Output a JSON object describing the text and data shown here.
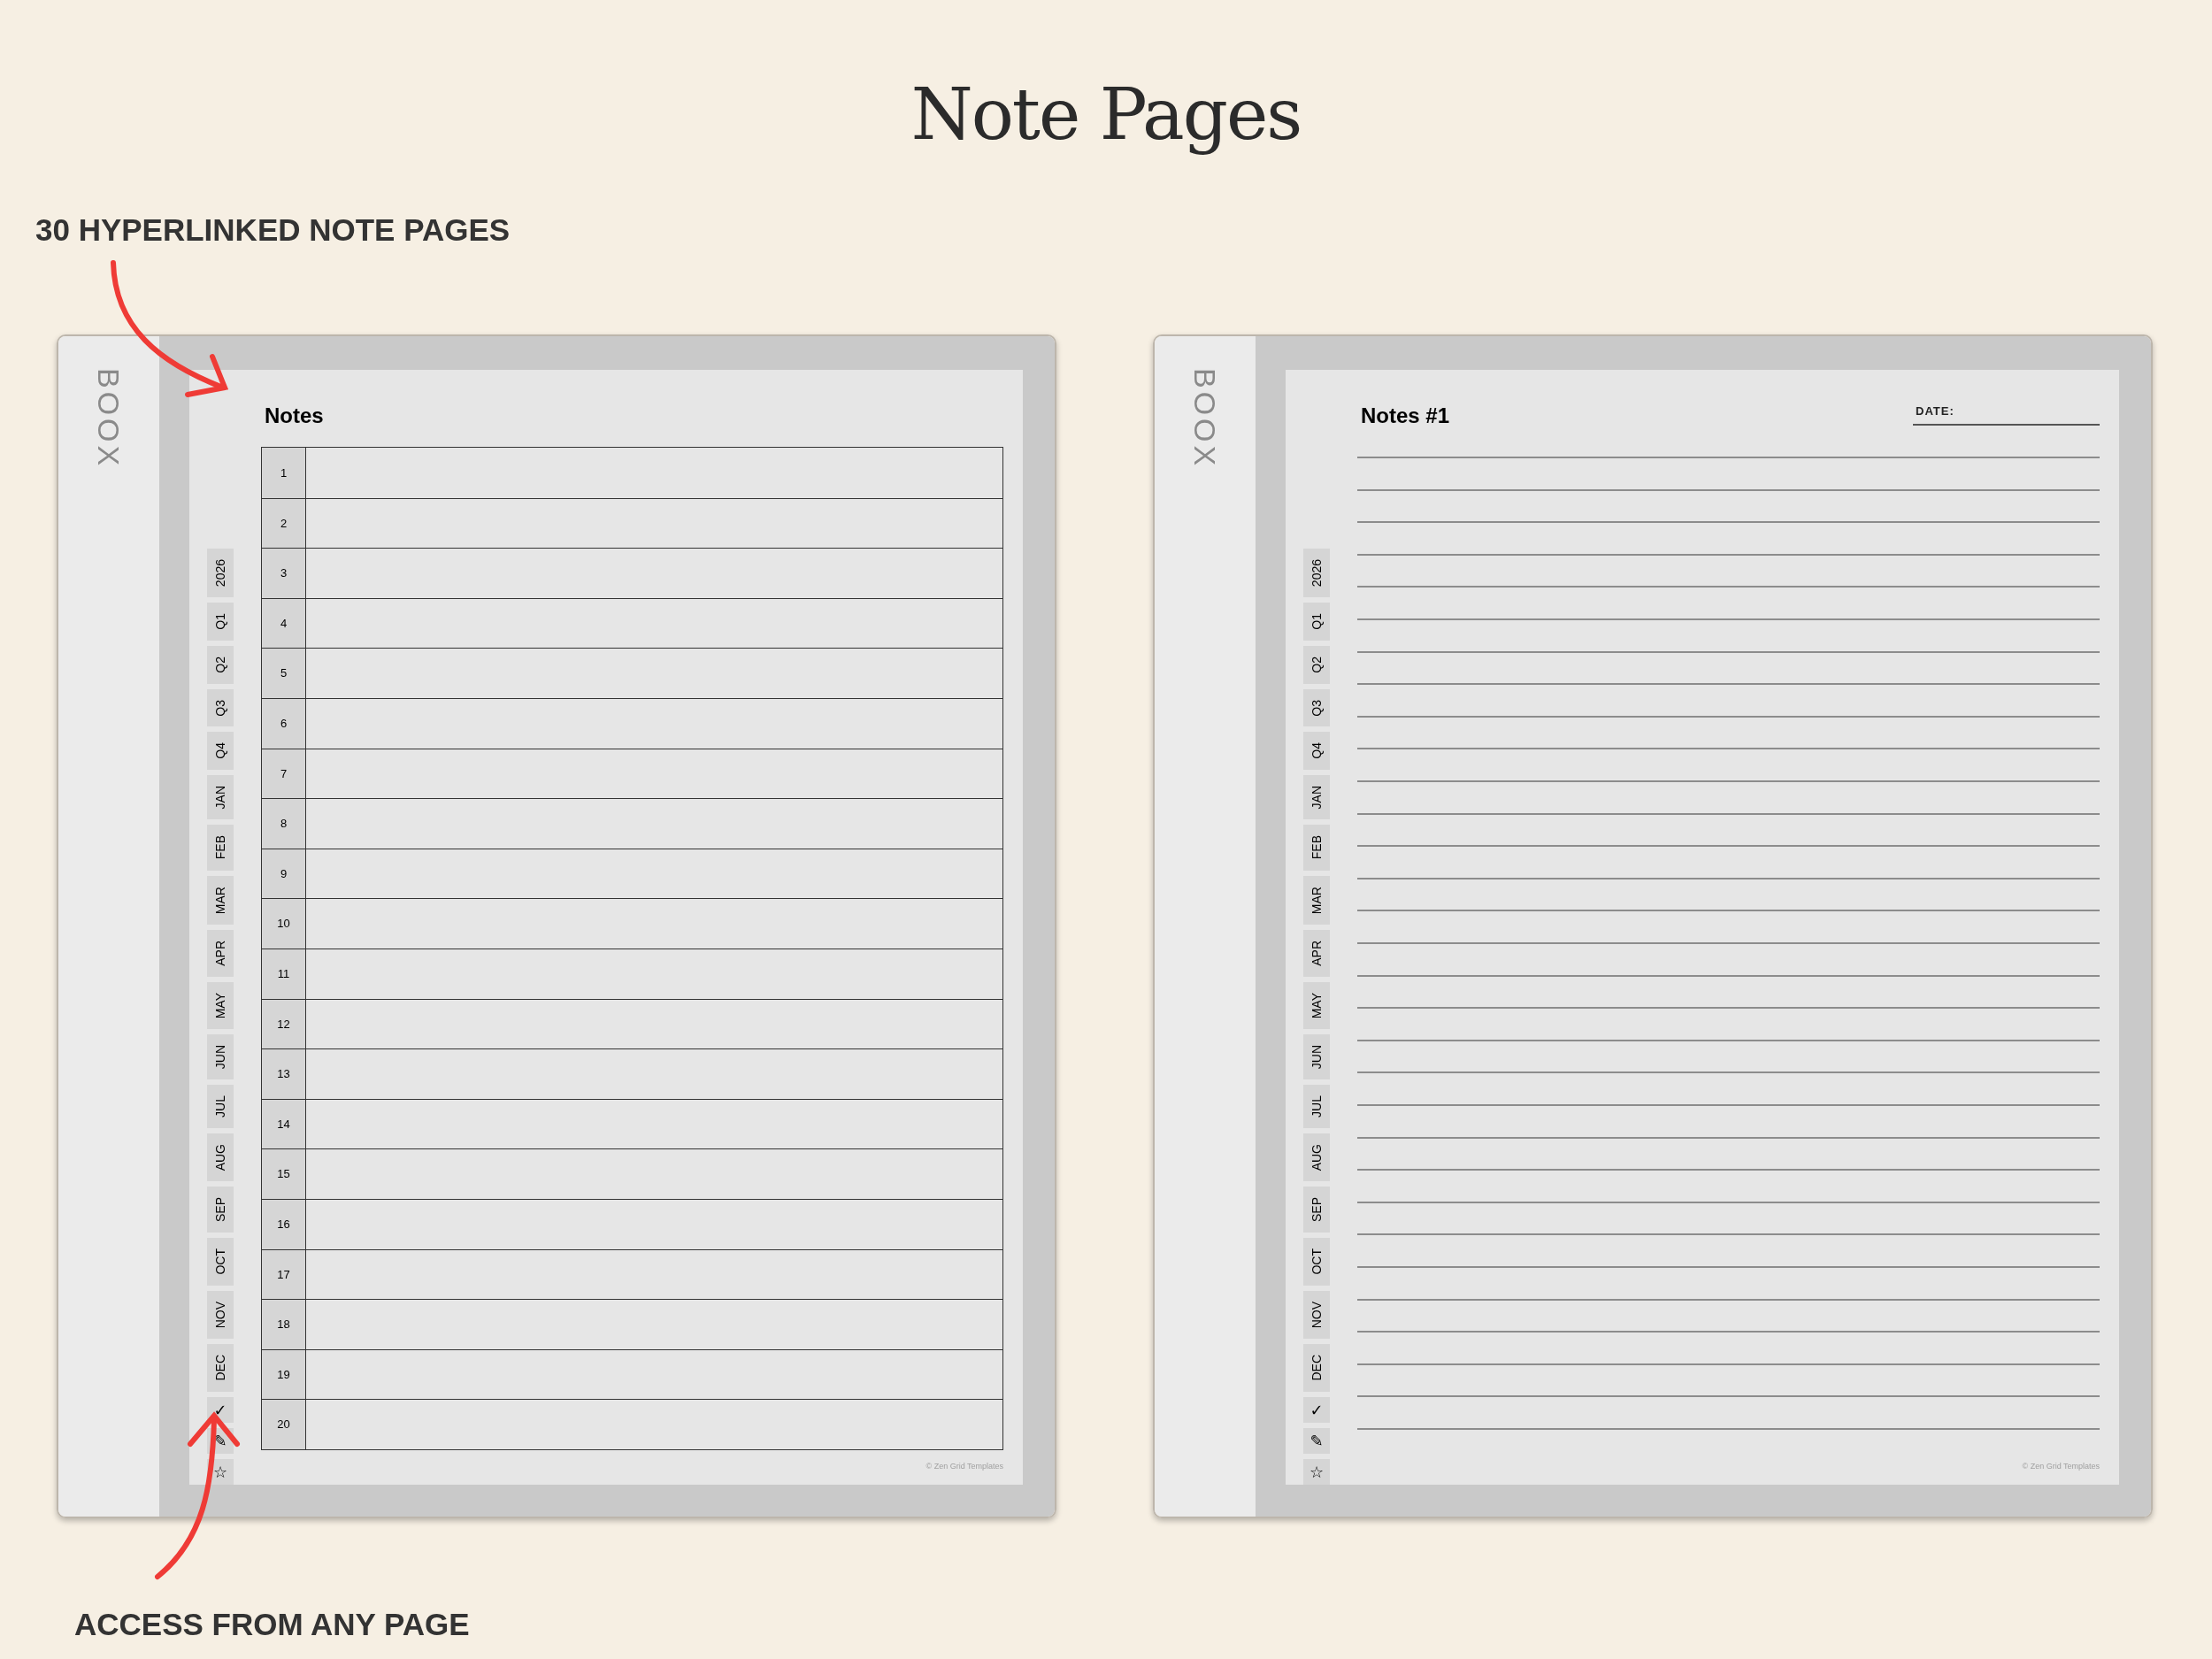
{
  "title": "Note Pages",
  "callouts": [
    {
      "text": "30 HYPERLINKED NOTE PAGES"
    },
    {
      "text": "ACCESS FROM ANY PAGE"
    }
  ],
  "devices": [
    {
      "brand": "BOOX",
      "kind": "index",
      "heading": "Notes",
      "tabs": [
        "2026",
        "Q1",
        "Q2",
        "Q3",
        "Q4",
        "JAN",
        "FEB",
        "MAR",
        "APR",
        "MAY",
        "JUN",
        "JUL",
        "AUG",
        "SEP",
        "OCT",
        "NOV",
        "DEC",
        "✓",
        "✎",
        "☆"
      ],
      "rows": [
        "1",
        "2",
        "3",
        "4",
        "5",
        "6",
        "7",
        "8",
        "9",
        "10",
        "11",
        "12",
        "13",
        "14",
        "15",
        "16",
        "17",
        "18",
        "19",
        "20"
      ],
      "footer": "© Zen Grid Templates"
    },
    {
      "brand": "BOOX",
      "kind": "lined",
      "heading": "Notes #1",
      "date_label": "DATE:",
      "tabs": [
        "2026",
        "Q1",
        "Q2",
        "Q3",
        "Q4",
        "JAN",
        "FEB",
        "MAR",
        "APR",
        "MAY",
        "JUN",
        "JUL",
        "AUG",
        "SEP",
        "OCT",
        "NOV",
        "DEC",
        "✓",
        "✎",
        "☆"
      ],
      "footer": "© Zen Grid Templates"
    }
  ]
}
